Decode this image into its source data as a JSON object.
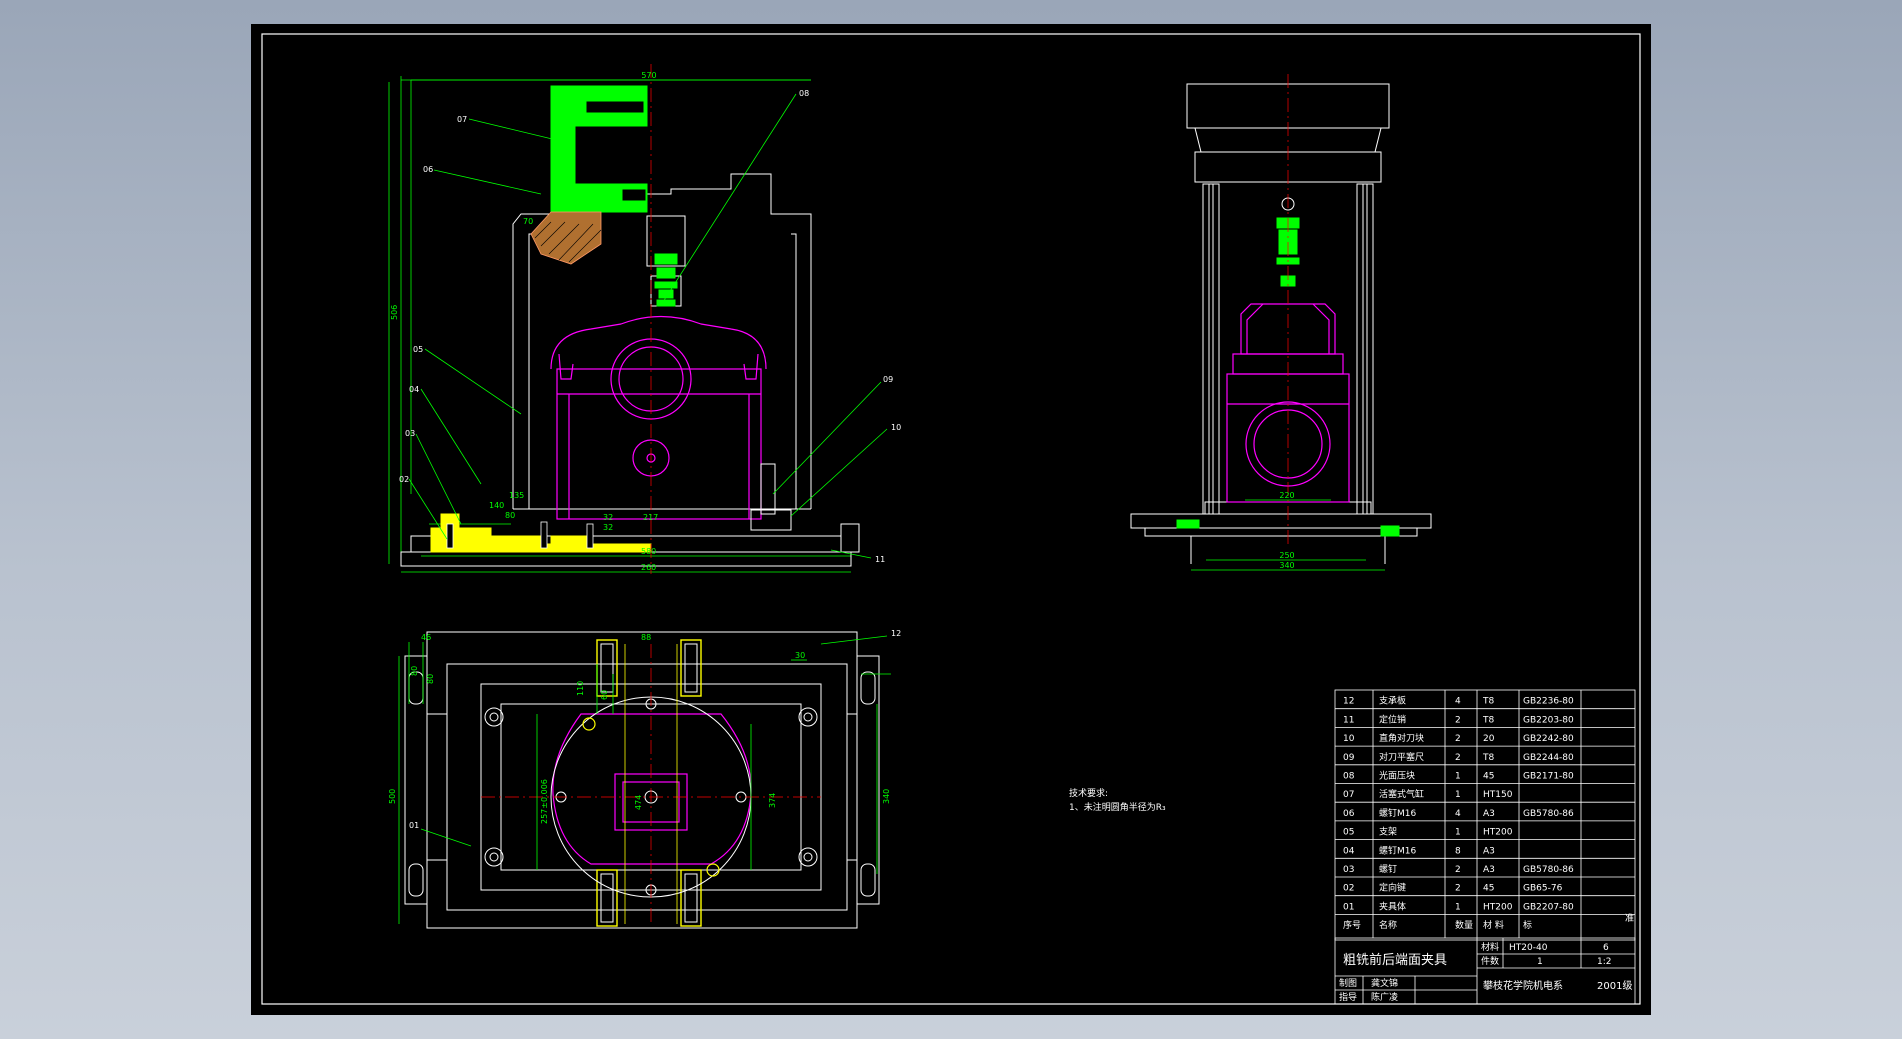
{
  "colors": {
    "background": "#000000",
    "frame": "#ffffff",
    "outline": "#ffffff",
    "dimension": "#00ff00",
    "workpiece": "#ff00ff",
    "centerline": "#ff0000",
    "highlight_green": "#00ff00",
    "highlight_yellow": "#ffff00",
    "leader": "#00ff00"
  },
  "front_view": {
    "dims": {
      "d570": "570",
      "d506": "506",
      "d217": "217",
      "d580": "580",
      "d260": "260",
      "d32a": "32",
      "d32b": "32",
      "d140": "140",
      "d135": "135",
      "d80": "80",
      "d70": "70"
    },
    "callouts": {
      "c08": "08",
      "c07": "07",
      "c06": "06",
      "c05": "05",
      "c04": "04",
      "c03": "03",
      "c02": "02",
      "c09": "09",
      "c10": "10",
      "c11": "11"
    }
  },
  "side_view": {
    "dims": {
      "d250": "250",
      "d340": "340",
      "d220": "220"
    }
  },
  "top_view": {
    "dims": {
      "d46": "46",
      "d80a": "80",
      "d80b": "80",
      "d500": "500",
      "d110": "110",
      "d60": "60",
      "d340": "340",
      "d374": "374",
      "d257": "257±0.006",
      "d474": "474",
      "d30": "30",
      "d88": "88"
    },
    "callouts": {
      "c01": "01",
      "c12": "12"
    }
  },
  "notes": {
    "heading": "技术要求:",
    "line1": "1、未注明圆角半径为R₃"
  },
  "bom": {
    "rows": [
      {
        "no": "12",
        "name": "支承板",
        "qty": "4",
        "material": "T8",
        "std": "GB2236-80"
      },
      {
        "no": "11",
        "name": "定位销",
        "qty": "2",
        "material": "T8",
        "std": "GB2203-80"
      },
      {
        "no": "10",
        "name": "直角对刀块",
        "qty": "2",
        "material": "20",
        "std": "GB2242-80"
      },
      {
        "no": "09",
        "name": "对刀平塞尺",
        "qty": "2",
        "material": "T8",
        "std": "GB2244-80"
      },
      {
        "no": "08",
        "name": "光面压块",
        "qty": "1",
        "material": "45",
        "std": "GB2171-80"
      },
      {
        "no": "07",
        "name": "活塞式气缸",
        "qty": "1",
        "material": "HT150",
        "std": ""
      },
      {
        "no": "06",
        "name": "螺钉M16",
        "qty": "4",
        "material": "A3",
        "std": "GB5780-86"
      },
      {
        "no": "05",
        "name": "支架",
        "qty": "1",
        "material": "HT200",
        "std": ""
      },
      {
        "no": "04",
        "name": "螺钉M16",
        "qty": "8",
        "material": "A3",
        "std": ""
      },
      {
        "no": "03",
        "name": "螺钉",
        "qty": "2",
        "material": "A3",
        "std": "GB5780-86"
      },
      {
        "no": "02",
        "name": "定向键",
        "qty": "2",
        "material": "45",
        "std": "GB65-76"
      },
      {
        "no": "01",
        "name": "夹具体",
        "qty": "1",
        "material": "HT200",
        "std": "GB2207-80"
      }
    ],
    "header": {
      "no": "序号",
      "name": "名称",
      "qty": "数量",
      "material": "材 料",
      "std": "标",
      "extra": "准"
    }
  },
  "title_block": {
    "title": "粗铣前后端面夹具",
    "material_label": "材料",
    "material_value": "HT20-40",
    "material_num": "6",
    "count_label": "件数",
    "count_value": "1",
    "scale": "1:2",
    "drawn_label": "制图",
    "drawn_name": "龚文锦",
    "guide_label": "指导",
    "guide_name": "陈广凌",
    "school": "攀枝花学院机电系",
    "class": "2001级"
  }
}
